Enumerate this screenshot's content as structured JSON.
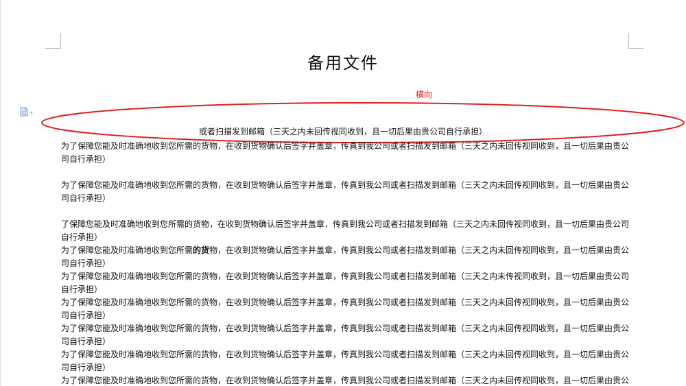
{
  "document": {
    "title": "备用文件",
    "annotation_label": "横向",
    "centered_line": "或者扫描发到邮箱（三天之内未回传视同收到，且一切后果由贵公司自行承担）"
  },
  "paragraphs": [
    {
      "text": "为了保障您能及时准确地收到您所需的货物，在收到货物确认后签字并盖章，传真到我公司或者扫描发到邮箱（三天之内未回传视同收到，且一切后果由贵公司自行承担）",
      "gap_before": false
    },
    {
      "text": "为了保障您能及时准确地收到您所需的货物，在收到货物确认后签字并盖章，传真到我公司或者扫描发到邮箱（三天之内未回传视同收到，且一切后果由贵公司自行承担）",
      "gap_before": true
    },
    {
      "text": "了保障您能及时准确地收到您所需的货物，在收到货物确认后签字并盖章，传真到我公司或者扫描发到邮箱（三天之内未回传视同收到，且一切后果由贵公司自行承担）",
      "gap_before": true
    },
    {
      "pre": "为了保障您能及时准确地收到您所需",
      "bold": "的货",
      "post": "物，在收到货物确认后签字并盖章，传真到我公司或者扫描发到邮箱（三天之内未回传视同收到，且一切后果由贵公司自行承担）",
      "gap_before": false
    },
    {
      "text": "为了保障您能及时准确地收到您所需的货物，在收到货物确认后签字并盖章，传真到我公司或者扫描发到邮箱（三天之内未传视同收到，且一切后果由贵公司自行承担）",
      "gap_before": false
    },
    {
      "text": "为了保障您能及时准确地收到您所需的货物，在收到货物确认后签字并盖章，传真到我公司或者扫描发到邮箱（三天之内未回传视同收到，且一切后果由贵公司自行承担）",
      "gap_before": false
    },
    {
      "text": "为了保障您能及时准确地收到您所需的货物，在收到货物确认后签字并盖章，传真到我公司或者扫描发到邮箱（三天之内未回传视同收到，且一切后果由贵公司自行承担）",
      "gap_before": false
    },
    {
      "text": "为了保障您能及时准确地收到您所需的货物，在收到货物确认后签字并盖章，传真到我公司或者扫描发到邮箱（三天之内未回传视同收到，且一切后果由贵公司自行承担）",
      "gap_before": false
    },
    {
      "text": "为了保障您能及时准确地收到您所需的货物，在收到货物确认后签字并盖章，传真到我公司或者扫描发到邮箱（三天之内未回传视同收到，且一切后果由贵公司自行承担）",
      "gap_before": false
    }
  ],
  "colors": {
    "annotation": "#e0201c",
    "text": "#111111"
  },
  "icons": {
    "margin": "document-comment-icon"
  }
}
